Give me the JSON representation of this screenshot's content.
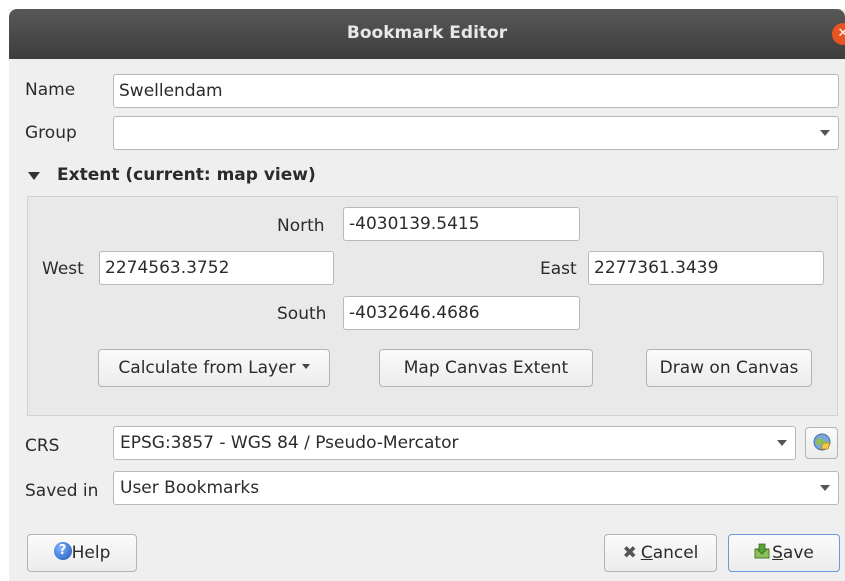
{
  "window": {
    "title": "Bookmark Editor"
  },
  "fields": {
    "name_label": "Name",
    "name_value": "Swellendam",
    "group_label": "Group",
    "group_value": ""
  },
  "extent": {
    "header": "Extent (current: map view)",
    "north_label": "North",
    "north_value": "-4030139.5415",
    "west_label": "West",
    "west_value": "2274563.3752",
    "east_label": "East",
    "east_value": "2277361.3439",
    "south_label": "South",
    "south_value": "-4032646.4686",
    "calculate_label": "Calculate from Layer",
    "map_canvas_label": "Map Canvas Extent",
    "draw_label": "Draw on Canvas"
  },
  "crs": {
    "label": "CRS",
    "value": "EPSG:3857 - WGS 84 / Pseudo-Mercator"
  },
  "saved_in": {
    "label": "Saved in",
    "value": "User Bookmarks"
  },
  "buttons": {
    "help": "Help",
    "cancel_mnemonic": "C",
    "cancel_rest": "ancel",
    "save_mnemonic": "S",
    "save_rest": "ave"
  },
  "icons": {
    "close": "close-icon",
    "help": "help-icon",
    "cancel": "cancel-icon",
    "save": "save-icon",
    "crs_select": "globe-icon",
    "expand": "triangle-down-icon"
  },
  "colors": {
    "titlebar": "#3d3d3d",
    "close": "#e95420",
    "dialog_bg": "#efefef"
  }
}
